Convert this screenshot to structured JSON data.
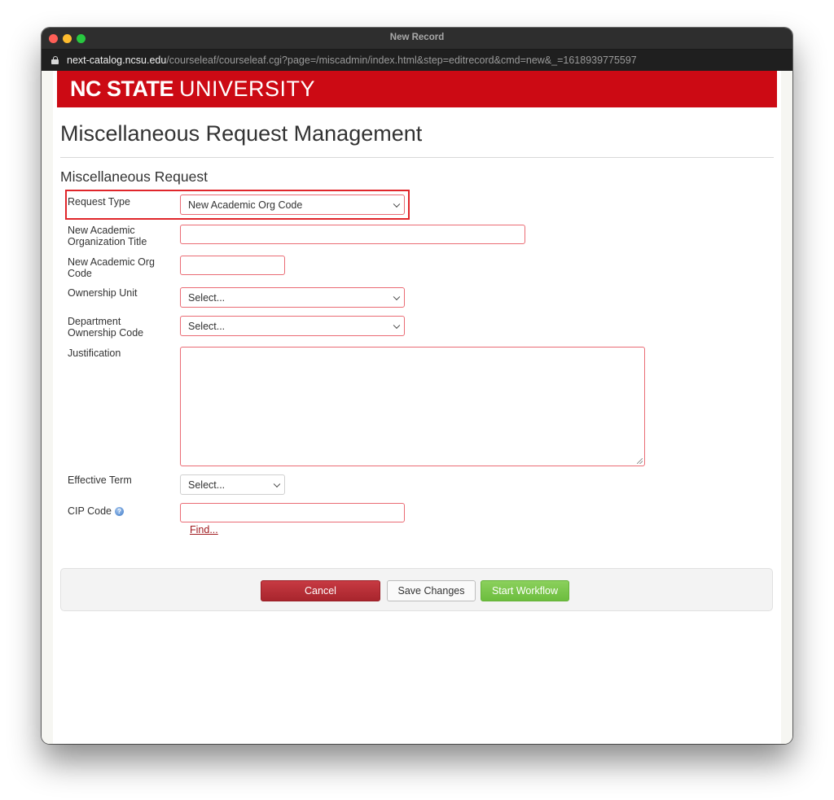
{
  "window": {
    "title": "New Record",
    "url_host": "next-catalog.ncsu.edu",
    "url_path": "/courseleaf/courseleaf.cgi?page=/miscadmin/index.html&step=editrecord&cmd=new&_=1618939775597"
  },
  "banner": {
    "brand_bold": "NC STATE",
    "brand_light": "UNIVERSITY",
    "color": "#cc0a14"
  },
  "page": {
    "title": "Miscellaneous Request Management",
    "section_title": "Miscellaneous Request"
  },
  "form": {
    "request_type": {
      "label": "Request Type",
      "value": "New Academic Org Code"
    },
    "org_title": {
      "label": "New Academic Organization Title",
      "value": ""
    },
    "org_code": {
      "label": "New Academic Org Code",
      "value": ""
    },
    "ownership_unit": {
      "label": "Ownership Unit",
      "value": "Select..."
    },
    "dept_ownership_code": {
      "label": "Department Ownership Code",
      "value": "Select..."
    },
    "justification": {
      "label": "Justification",
      "value": ""
    },
    "effective_term": {
      "label": "Effective Term",
      "value": "Select..."
    },
    "cip_code": {
      "label": "CIP Code",
      "value": "",
      "find_link": "Find...",
      "help_icon": "help-icon"
    }
  },
  "actions": {
    "cancel": "Cancel",
    "save": "Save Changes",
    "start_workflow": "Start Workflow"
  },
  "colors": {
    "required_border": "#ea6b74",
    "cancel": "#b8303a",
    "start_workflow": "#7ac64c",
    "highlight": "#e0262b"
  }
}
